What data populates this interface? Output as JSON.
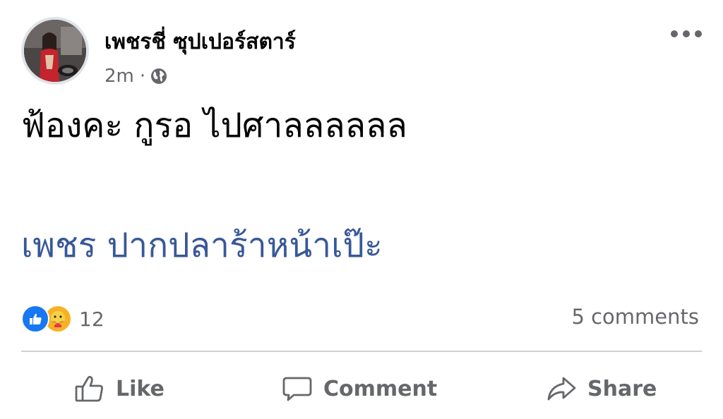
{
  "post": {
    "author": "เพชรชี่ ซุปเปอร์สตาร์",
    "time": "2m",
    "separator": "·",
    "privacy_icon": "globe-icon",
    "text": "ฟ้องคะ กูรอ ไปศาลลลลลล",
    "link_text": "เพชร ปากปลาร้าหน้าเป๊ะ"
  },
  "reactions": {
    "icons": [
      "like-icon",
      "care-icon"
    ],
    "count": "12"
  },
  "comments": {
    "label": "5 comments"
  },
  "actions": {
    "like": "Like",
    "comment": "Comment",
    "share": "Share"
  },
  "colors": {
    "link": "#385898",
    "secondary_text": "#65676b",
    "like_blue": "#1877f2",
    "care_yellow": "#f7b125",
    "divider": "#ced0d4"
  }
}
